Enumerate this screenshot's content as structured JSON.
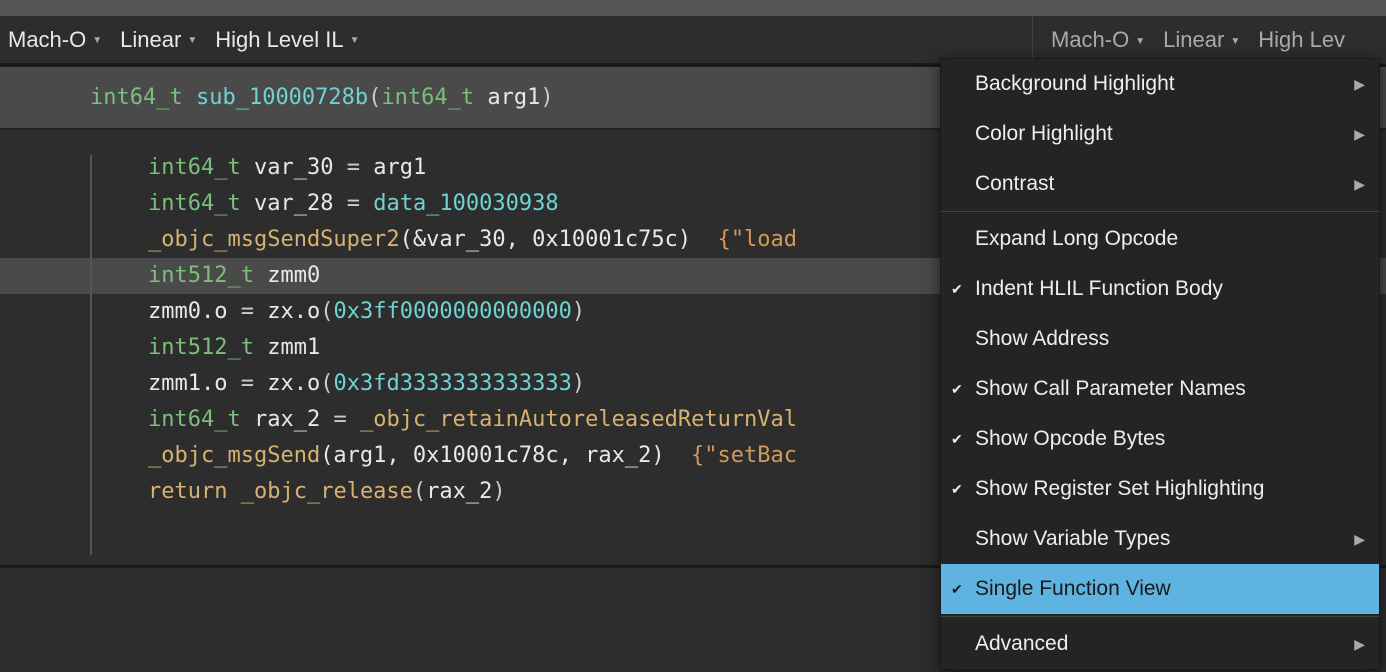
{
  "toolbar_left": {
    "dropdowns": [
      {
        "label": "Mach-O"
      },
      {
        "label": "Linear"
      },
      {
        "label": "High Level IL"
      }
    ]
  },
  "second_toolbar": {
    "dropdowns": [
      {
        "label": "Mach-O"
      },
      {
        "label": "Linear"
      },
      {
        "label": "High Lev"
      }
    ]
  },
  "signature": {
    "ret_type": "int64_t",
    "name": "sub_10000728b",
    "arg_type": "int64_t",
    "arg_name": "arg1"
  },
  "code": {
    "l1": {
      "type": "int64_t",
      "var": "var_30",
      "op": "=",
      "rhs": "arg1"
    },
    "l2": {
      "type": "int64_t",
      "var": "var_28",
      "op": "=",
      "rhs": "data_100030938"
    },
    "l3": {
      "func": "_objc_msgSendSuper2",
      "args": "(&var_30, 0x10001c75c)",
      "comment": "  {\"load"
    },
    "l4": {
      "type": "int512_t",
      "var": "zmm0"
    },
    "l5": {
      "lhs": "zmm0.o",
      "op": "=",
      "f": "zx.o",
      "num": "0x3ff0000000000000"
    },
    "l6": {
      "type": "int512_t",
      "var": "zmm1"
    },
    "l7": {
      "lhs": "zmm1.o",
      "op": "=",
      "f": "zx.o",
      "num": "0x3fd3333333333333"
    },
    "l8": {
      "type": "int64_t",
      "var": "rax_2",
      "op": "=",
      "func": "_objc_retainAutoreleasedReturnVal"
    },
    "l9": {
      "func": "_objc_msgSend",
      "args": "(arg1, 0x10001c78c, rax_2)",
      "comment": "  {\"setBac"
    },
    "l10": {
      "kw": "return",
      "func": "_objc_release",
      "arg": "rax_2"
    }
  },
  "menu": {
    "items": [
      {
        "label": "Background Highlight",
        "submenu": true,
        "checked": false
      },
      {
        "label": "Color Highlight",
        "submenu": true,
        "checked": false
      },
      {
        "label": "Contrast",
        "submenu": true,
        "checked": false
      },
      {
        "sep": true
      },
      {
        "label": "Expand Long Opcode",
        "submenu": false,
        "checked": false
      },
      {
        "label": "Indent HLIL Function Body",
        "submenu": false,
        "checked": true
      },
      {
        "label": "Show Address",
        "submenu": false,
        "checked": false
      },
      {
        "label": "Show Call Parameter Names",
        "submenu": false,
        "checked": true
      },
      {
        "label": "Show Opcode Bytes",
        "submenu": false,
        "checked": true
      },
      {
        "label": "Show Register Set Highlighting",
        "submenu": false,
        "checked": true
      },
      {
        "label": "Show Variable Types",
        "submenu": true,
        "checked": false
      },
      {
        "label": "Single Function View",
        "submenu": false,
        "checked": true,
        "highlight": true
      },
      {
        "sep": true
      },
      {
        "label": "Advanced",
        "submenu": true,
        "checked": false
      }
    ]
  }
}
